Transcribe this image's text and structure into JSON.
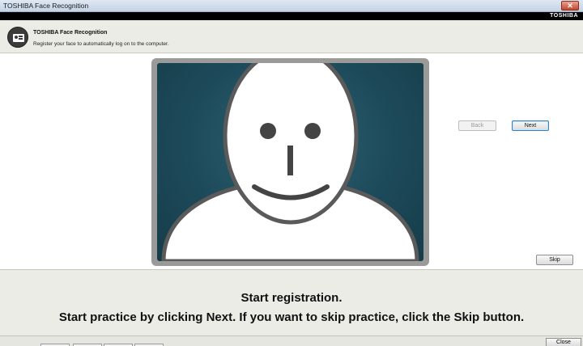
{
  "window": {
    "title": "TOSHIBA Face Recognition",
    "close_glyph": "✕"
  },
  "brand": {
    "label": "TOSHIBA"
  },
  "header": {
    "title": "TOSHIBA Face Recognition",
    "subtitle": "Register your face to automatically log on to the computer.",
    "icon": "id-card-icon"
  },
  "navigation": {
    "back_label": "Back",
    "next_label": "Next",
    "skip_label": "Skip"
  },
  "instructions": {
    "line1": "Start registration.",
    "line2": "Start practice by clicking Next. If you want to skip practice, click the Skip button."
  },
  "footer": {
    "close_label": "Close"
  },
  "colors": {
    "camera_background": "#1d4a5a",
    "face_fill": "#ffffff",
    "face_outline": "#555555",
    "header_background": "#ecece6"
  }
}
